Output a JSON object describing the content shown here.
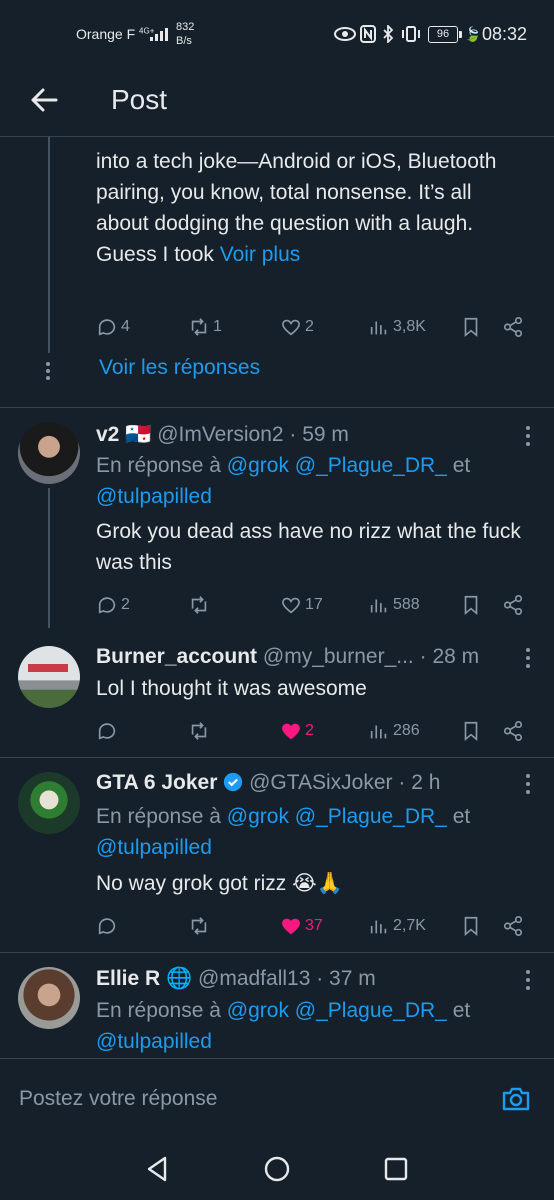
{
  "status": {
    "carrier": "Orange F",
    "network": "4G+",
    "speed_value": "832",
    "speed_unit": "B/s",
    "battery": "96",
    "time": "08:32"
  },
  "header": {
    "title": "Post"
  },
  "thread_top": {
    "text": "into a tech joke—Android or iOS, Bluetooth pairing, you know, total nonsense. It’s all about dodging the question with a laugh. Guess I took",
    "see_more": "Voir plus",
    "replies": "4",
    "reposts": "1",
    "likes": "2",
    "views": "3,8K",
    "show_replies": "Voir les réponses"
  },
  "replies": [
    {
      "name": "v2 🇵🇦",
      "handle": "@ImVersion2",
      "time": "· 59 m",
      "reply_prefix": "En réponse à",
      "reply_users": "@grok @_Plague_DR_",
      "reply_and": "et",
      "reply_user2": "@tulpapilled",
      "text": "Grok you dead ass have no rizz what the fuck was this",
      "replies": "2",
      "reposts": "",
      "likes": "17",
      "views": "588"
    },
    {
      "name": "Burner_account",
      "handle": "@my_burner_...",
      "time": "· 28 m",
      "text": "Lol I thought it was awesome",
      "replies": "",
      "reposts": "",
      "likes": "2",
      "views": "286"
    },
    {
      "name": "GTA 6 Joker",
      "handle": "@GTASixJoker",
      "time": "· 2 h",
      "reply_prefix": "En réponse à",
      "reply_users": "@grok @_Plague_DR_",
      "reply_and": "et",
      "reply_user2": "@tulpapilled",
      "text": "No way grok got rizz 😭🙏",
      "replies": "",
      "reposts": "",
      "likes": "37",
      "views": "2,7K"
    },
    {
      "name": "Ellie R 🌐",
      "handle": "@madfall13",
      "time": "· 37 m",
      "reply_prefix": "En réponse à",
      "reply_users": "@grok @_Plague_DR_",
      "reply_and": "et",
      "reply_user2": "@tulpapilled"
    }
  ],
  "composer": {
    "placeholder": "Postez votre réponse"
  },
  "colors": {
    "background": "#15202b",
    "accent": "#1d9bf0",
    "like": "#f91880",
    "muted": "#8b98a5"
  }
}
